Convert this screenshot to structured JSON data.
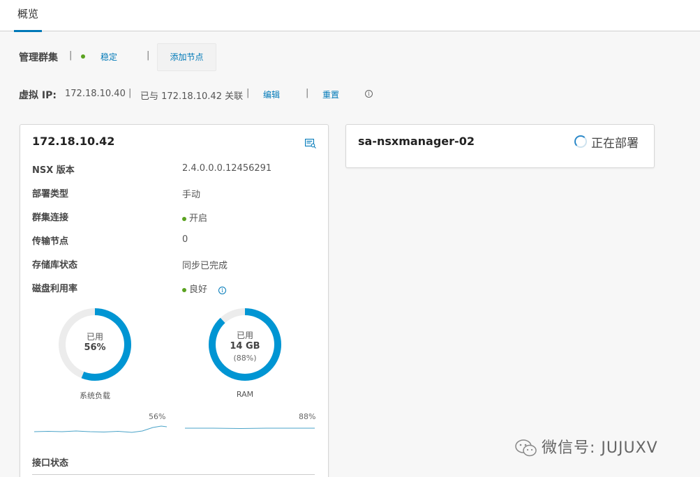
{
  "tabs": [
    {
      "label": "概览"
    }
  ],
  "management_cluster": {
    "label": "管理群集",
    "sep": "|",
    "status": "稳定",
    "status_color": "#5aa220",
    "add_node": "添加节点"
  },
  "virtual_ip": {
    "label": "虚拟 IP:",
    "ip": "172.18.10.40",
    "associated": "已与 172.18.10.42 关联",
    "edit": "编辑",
    "reset": "重置"
  },
  "node_card": {
    "title": "172.18.10.42",
    "props": [
      {
        "label": "NSX 版本",
        "value": "2.4.0.0.0.12456291"
      },
      {
        "label": "部署类型",
        "value": "手动"
      },
      {
        "label": "群集连接",
        "value": "开启"
      },
      {
        "label": "传输节点",
        "value": "0"
      },
      {
        "label": "存储库状态",
        "value": "同步已完成"
      },
      {
        "label": "磁盘利用率",
        "value": "良好"
      }
    ],
    "system_load": {
      "used_label": "已用",
      "percent_text": "56%",
      "percent": 56,
      "caption": "系统负载",
      "spark_label": "56%"
    },
    "ram": {
      "used_label": "已用",
      "amount_text": "14 GB",
      "percent_text": "(88%)",
      "percent": 88,
      "caption": "RAM",
      "spark_label": "88%"
    },
    "interface_status": "接口状态"
  },
  "deploying_card": {
    "title": "sa-nsxmanager-02",
    "status": "正在部署"
  },
  "watermark": "微信号: JUJUXV",
  "colors": {
    "accent": "#0079b8",
    "donut": "#0095d3",
    "donut_track": "#ececec",
    "ok_green": "#5aa220"
  }
}
